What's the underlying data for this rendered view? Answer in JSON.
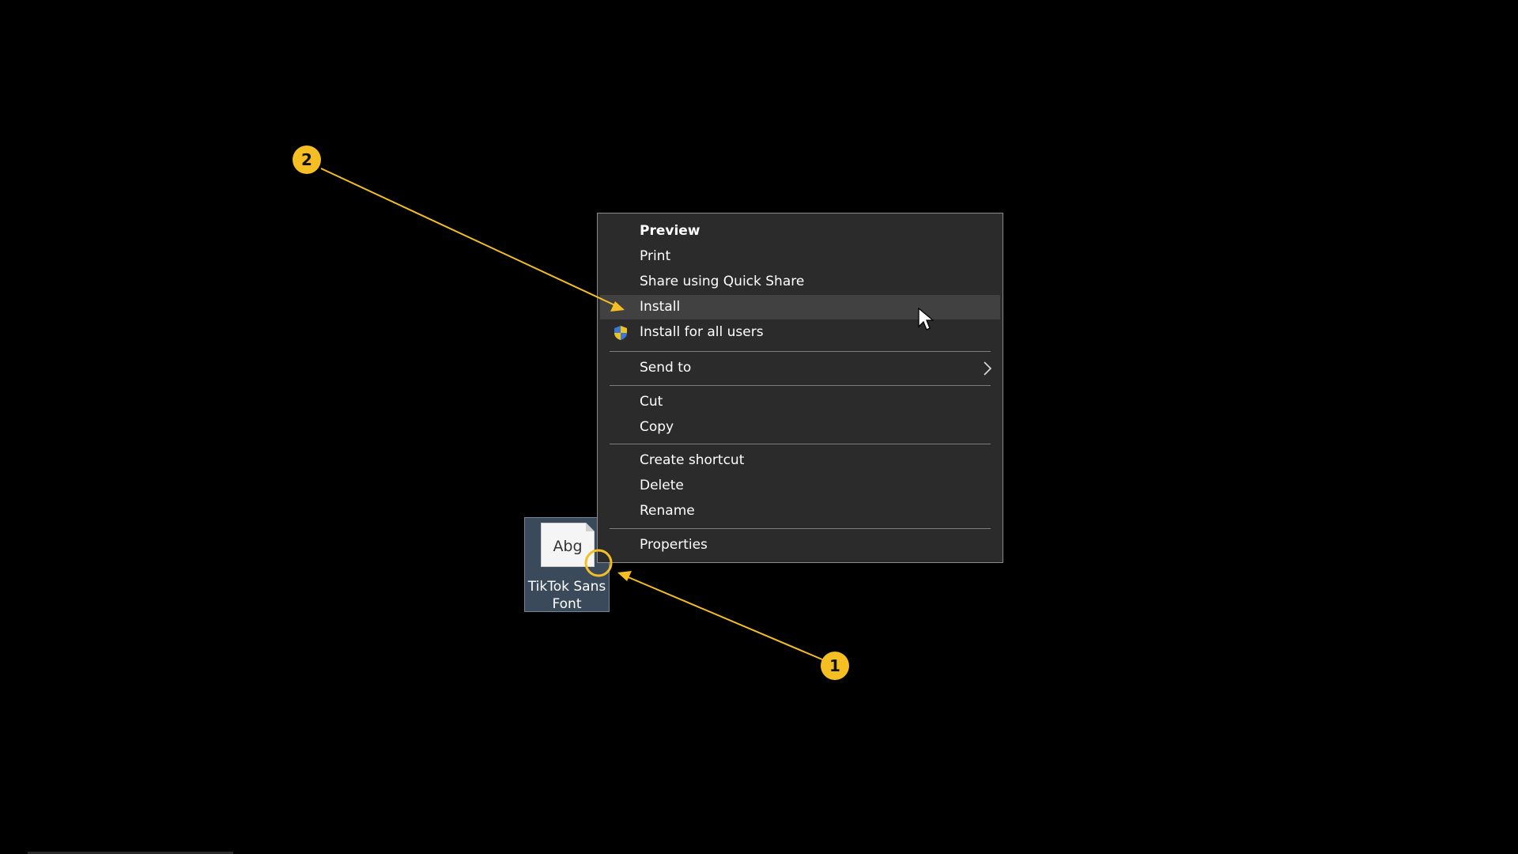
{
  "desktop_icon": {
    "preview_text": "Abg",
    "label_line1": "TikTok Sans",
    "label_line2": "Font"
  },
  "context_menu": {
    "items": [
      {
        "label": "Preview"
      },
      {
        "label": "Print"
      },
      {
        "label": "Share using Quick Share"
      },
      {
        "label": "Install"
      },
      {
        "label": "Install for all users"
      },
      {
        "label": "Send to"
      },
      {
        "label": "Cut"
      },
      {
        "label": "Copy"
      },
      {
        "label": "Create shortcut"
      },
      {
        "label": "Delete"
      },
      {
        "label": "Rename"
      },
      {
        "label": "Properties"
      }
    ]
  },
  "annotations": {
    "badge_1": "1",
    "badge_2": "2",
    "color": "#f5bf24"
  }
}
